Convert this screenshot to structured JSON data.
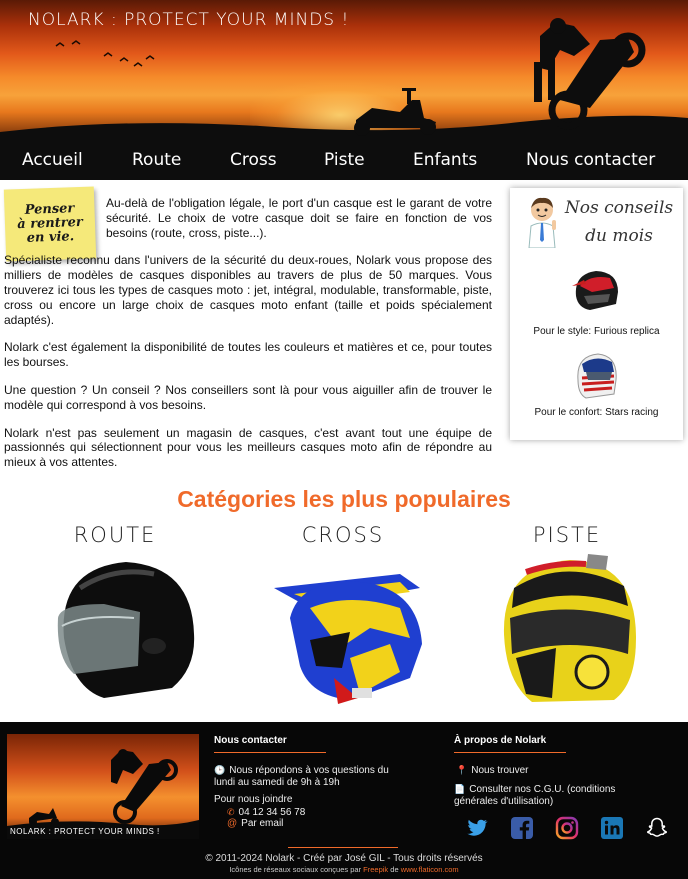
{
  "header": {
    "title": "Nolark : Protect your minds !"
  },
  "nav": {
    "items": [
      "Accueil",
      "Route",
      "Cross",
      "Piste",
      "Enfants",
      "Nous contacter"
    ]
  },
  "postit": {
    "text": "Penser\nà rentrer\nen vie."
  },
  "main": {
    "paragraphs": [
      "Au-delà de l'obligation légale, le port d'un casque est le garant de votre sécurité. Le choix de votre casque doit se faire en fonction de vos besoins (route, cross, piste...).",
      "Spécialiste reconnu dans l'univers de la sécurité du deux-roues, Nolark vous propose des milliers de modèles de casques disponibles au travers de plus de 50 marques. Vous trouverez ici tous les types de casques moto : jet, intégral, modulable, transformable, piste, cross ou encore un large choix de casques moto enfant (taille et poids spécialement adaptés).",
      "Nolark c'est également la disponibilité de toutes les couleurs et matières et ce, pour toutes les bourses.",
      "Une question ? Un conseil ? Nos conseillers sont là pour vous aiguiller afin de trouver le modèle qui correspond à vos besoins.",
      "Nolark n'est pas seulement un magasin de casques, c'est avant tout une équipe de passionnés qui sélectionnent pour vous les meilleurs casques moto afin de répondre au mieux à vos attentes."
    ]
  },
  "sidebar": {
    "title": "Nos conseils du mois",
    "items": [
      {
        "label": "Pour le style: Furious replica",
        "color": "#c81e1e"
      },
      {
        "label": "Pour le confort: Stars racing",
        "color": "#1c3a8a"
      }
    ]
  },
  "categories": {
    "title": "Catégories les plus populaires",
    "items": [
      {
        "label": "Route",
        "color": "#111111"
      },
      {
        "label": "Cross",
        "color": "#1f3fd0"
      },
      {
        "label": "Piste",
        "color": "#e8d21a"
      }
    ]
  },
  "footer": {
    "logo_text": "Nolark : Protect your minds !",
    "contact": {
      "heading": "Nous contacter",
      "hours": "Nous répondons à vos questions du lundi au samedi de 9h à 19h",
      "join": "Pour nous joindre",
      "phone": "04 12 34 56 78",
      "email": "Par email"
    },
    "about": {
      "heading": "À propos de Nolark",
      "find": "Nous trouver",
      "cgu": "Consulter nos C.G.U. (conditions générales d'utilisation)"
    },
    "social": [
      "twitter-icon",
      "facebook-icon",
      "instagram-icon",
      "linkedin-icon",
      "snapchat-icon"
    ],
    "copyright": "© 2011-2024 Nolark - Créé par José GIL - Tous droits réservés",
    "credits_prefix": "Icônes de réseaux sociaux conçues par",
    "credits_author": "Freepik",
    "credits_mid": "de",
    "credits_site": "www.flaticon.com",
    "accent": "#f06a2a"
  }
}
